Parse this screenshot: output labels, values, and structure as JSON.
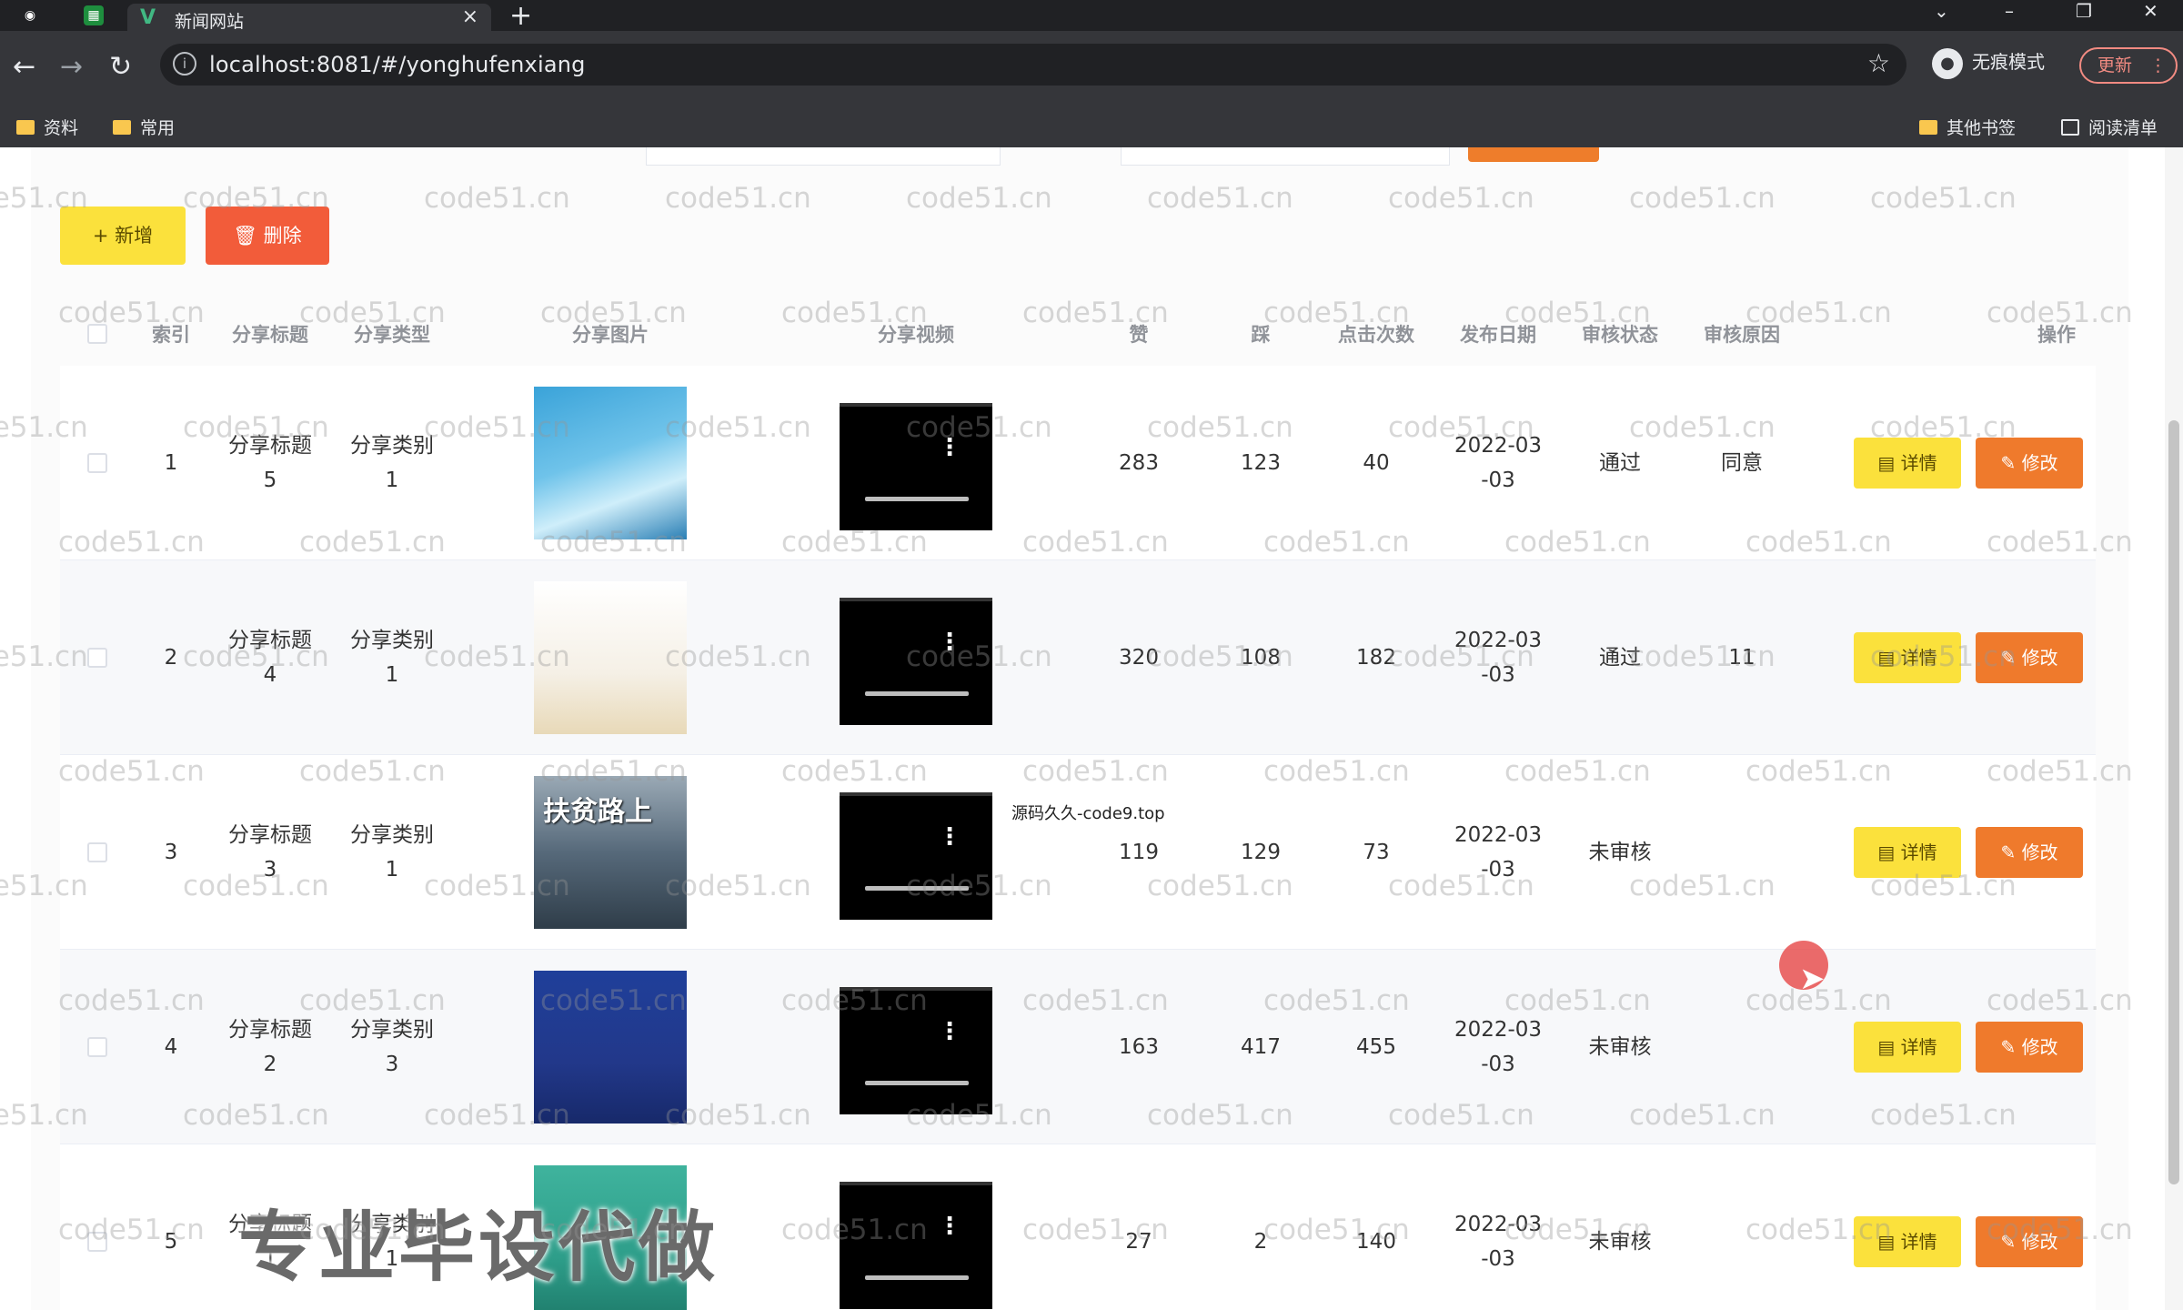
{
  "browser": {
    "tab_title": "新闻网站",
    "url": "localhost:8081/#/yonghufenxiang",
    "incognito_label": "无痕模式",
    "update_label": "更新",
    "bookmarks": [
      "资料",
      "常用"
    ],
    "bookmarks_right": [
      "其他书签",
      "阅读清单"
    ]
  },
  "toolbar": {
    "add_label": "+ 新增",
    "delete_label": "🗑 删除"
  },
  "table": {
    "headers": [
      "索引",
      "分享标题",
      "分享类型",
      "分享图片",
      "分享视频",
      "赞",
      "踩",
      "点击次数",
      "发布日期",
      "审核状态",
      "审核原因",
      "操作"
    ],
    "detail_label": "详情",
    "edit_label": "修改",
    "rows": [
      {
        "index": "1",
        "title": [
          "分享标题",
          "5"
        ],
        "type": [
          "分享类别",
          "1"
        ],
        "likes": "283",
        "dislikes": "123",
        "clicks": "40",
        "date": [
          "2022-03",
          "-03"
        ],
        "status": "通过",
        "reason": "同意"
      },
      {
        "index": "2",
        "title": [
          "分享标题",
          "4"
        ],
        "type": [
          "分享类别",
          "1"
        ],
        "likes": "320",
        "dislikes": "108",
        "clicks": "182",
        "date": [
          "2022-03",
          "-03"
        ],
        "status": "通过",
        "reason": "11"
      },
      {
        "index": "3",
        "title": [
          "分享标题",
          "3"
        ],
        "type": [
          "分享类别",
          "1"
        ],
        "likes": "119",
        "dislikes": "129",
        "clicks": "73",
        "date": [
          "2022-03",
          "-03"
        ],
        "status": "未审核",
        "reason": ""
      },
      {
        "index": "4",
        "title": [
          "分享标题",
          "2"
        ],
        "type": [
          "分享类别",
          "3"
        ],
        "likes": "163",
        "dislikes": "417",
        "clicks": "455",
        "date": [
          "2022-03",
          "-03"
        ],
        "status": "未审核",
        "reason": ""
      },
      {
        "index": "5",
        "title": [
          "分享标题",
          "1"
        ],
        "type": [
          "分享类别",
          "1"
        ],
        "likes": "27",
        "dislikes": "2",
        "clicks": "140",
        "date": [
          "2022-03",
          "-03"
        ],
        "status": "未审核",
        "reason": ""
      }
    ]
  },
  "watermark_text": "code51.cn",
  "overlay": {
    "banner": "专业毕设代做",
    "small": "源码久久-code9.top"
  },
  "image_texts": {
    "row3": "扶贫路上"
  },
  "colors": {
    "add": "#fbe13c",
    "delete": "#f25c3a",
    "detail": "#fbe13c",
    "edit": "#ef7a2c",
    "chrome": "#35363a"
  }
}
